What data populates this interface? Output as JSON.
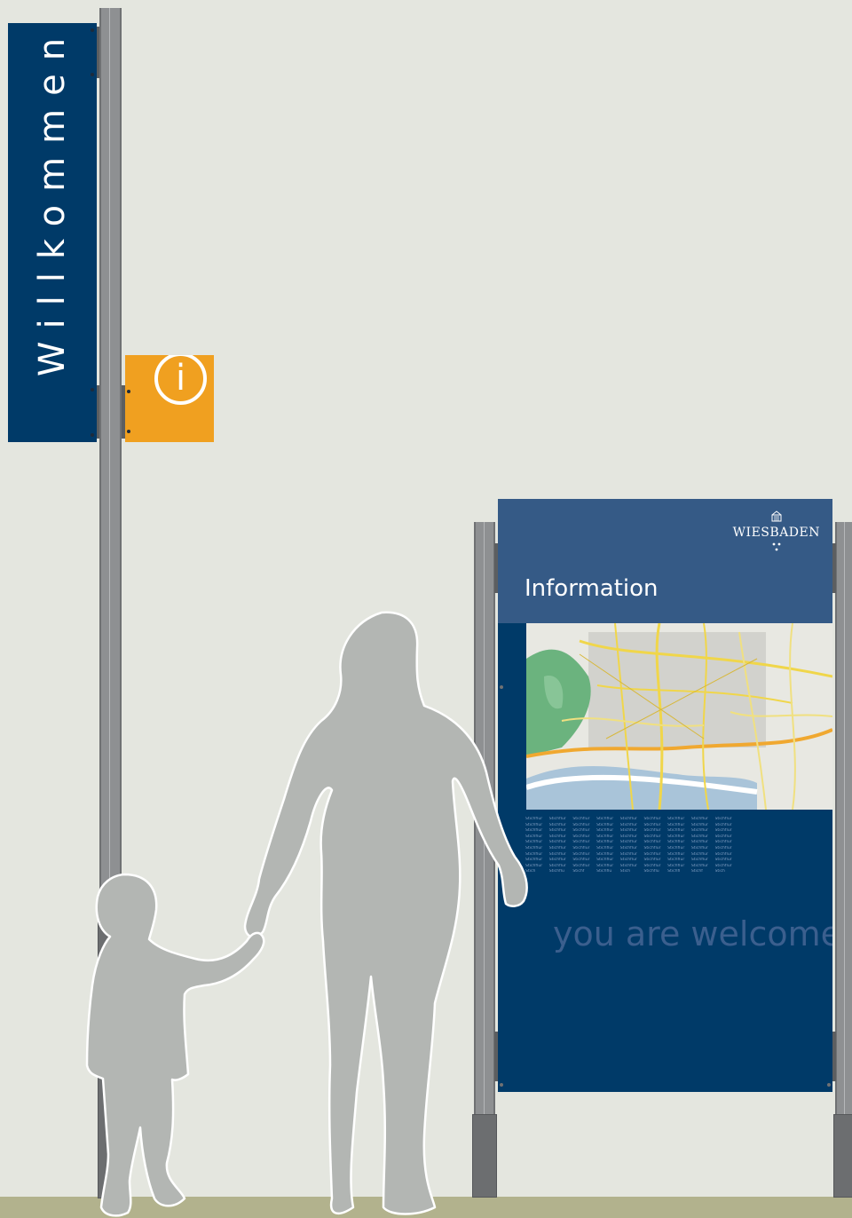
{
  "welcome_sign": {
    "text": "Willkommen"
  },
  "info_sign": {
    "glyph": "i"
  },
  "information_board": {
    "brand": "WIESBADEN",
    "title": "Information",
    "slogan": "you are welcome",
    "map_image": "city-map-image",
    "keywords": [
      [
        "Stichflur",
        "Stichflur",
        "Stichflur",
        "Stichflur",
        "Stichflur",
        "Stichflur",
        "Stichflur",
        "Stichflur",
        "Stichflur"
      ],
      [
        "Stichflur",
        "Stichflur",
        "Stichflur",
        "Stichflur",
        "Stichflur",
        "Stichflur",
        "Stichflur",
        "Stichflur",
        "Stichflur"
      ],
      [
        "Stichflur",
        "Stichflur",
        "Stichflur",
        "Stichflur",
        "Stichflur",
        "Stichflur",
        "Stichflur",
        "Stichflur",
        "Stichflur"
      ],
      [
        "Stichflur",
        "Stichflur",
        "Stichflur",
        "Stichflur",
        "Stichflur",
        "Stichflur",
        "Stichflur",
        "Stichflur",
        "Stichflur"
      ],
      [
        "Stichflur",
        "Stichflur",
        "Stichflur",
        "Stichflur",
        "Stichflur",
        "Stichflur",
        "Stichflur",
        "Stichflur",
        "Stichflur"
      ],
      [
        "Stichflur",
        "Stichflur",
        "Stichflur",
        "Stichflur",
        "Stichflur",
        "Stichflur",
        "Stichflur",
        "Stichflur",
        "Stichflur"
      ],
      [
        "Stichflur",
        "Stichflur",
        "Stichflur",
        "Stichflur",
        "Stichflur",
        "Stichflur",
        "Stichflur",
        "Stichflur",
        "Stichflur"
      ],
      [
        "Stichflur",
        "Stichflur",
        "Stichflur",
        "Stichflur",
        "Stichflur",
        "Stichflur",
        "Stichflur",
        "Stichflur",
        "Stichflur"
      ],
      [
        "Stichflur",
        "Stichflur",
        "Stichflur",
        "Stichflur",
        "Stichflur",
        "Stichflur",
        "Stichflur",
        "Stichflur",
        "Stichflur"
      ],
      [
        "Stich",
        "Stichflu",
        "Stichf",
        "Stichflu",
        "Stich",
        "Stichflu",
        "Stichfl",
        "Stichf",
        "Stich"
      ]
    ]
  },
  "colors": {
    "background": "#e4e6df",
    "navy": "#003a68",
    "header_blue": "#355a86",
    "orange": "#f0a020",
    "silhouette": "#b3b6b3"
  },
  "icons": [
    "info-icon",
    "coat-of-arms-icon",
    "crown-icon"
  ]
}
